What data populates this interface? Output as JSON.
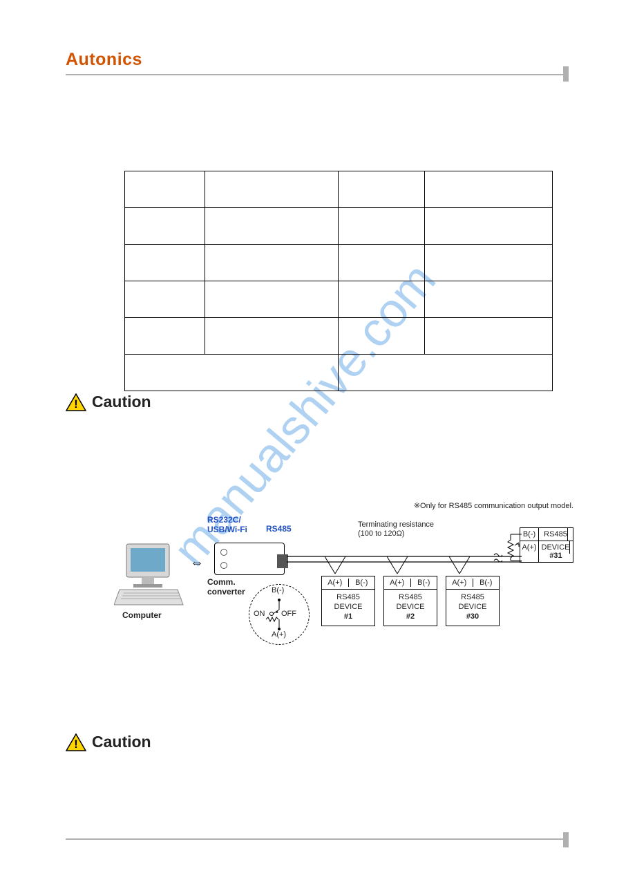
{
  "header": {
    "brand": "Autonics"
  },
  "spec_table": {
    "rows": [
      [
        "",
        "",
        "",
        ""
      ],
      [
        "",
        "",
        "",
        ""
      ],
      [
        "",
        "",
        "",
        ""
      ],
      [
        "",
        "",
        "",
        ""
      ],
      [
        "",
        "",
        "",
        ""
      ]
    ],
    "last_row": [
      "",
      ""
    ]
  },
  "cautions": {
    "label1": "Caution",
    "label2": "Caution",
    "icon_name": "warning-triangle-icon"
  },
  "diagram": {
    "note_top": "※Only for RS485 communication output model.",
    "rs232_label": "RS232C/\nUSB/Wi-Fi",
    "rs485_label": "RS485",
    "terminating_label": "Terminating resistance\n(100 to 120Ω)",
    "computer_label": "Computer",
    "converter_label": "Comm.\nconverter",
    "bubble": {
      "b_minus": "B(-)",
      "a_plus": "A(+)",
      "on": "ON",
      "off": "OFF"
    },
    "devices": [
      {
        "a": "A(+)",
        "b": "B(-)",
        "line1": "RS485",
        "line2": "DEVICE",
        "line3": "#1"
      },
      {
        "a": "A(+)",
        "b": "B(-)",
        "line1": "RS485",
        "line2": "DEVICE",
        "line3": "#2"
      },
      {
        "a": "A(+)",
        "b": "B(-)",
        "line1": "RS485",
        "line2": "DEVICE",
        "line3": "#30"
      }
    ],
    "device31": {
      "b": "B(-)",
      "a": "A(+)",
      "line1": "RS485",
      "line2": "DEVICE",
      "line3": "#31"
    },
    "arrow_symbol": "⇔",
    "bubble_dot": "•"
  }
}
